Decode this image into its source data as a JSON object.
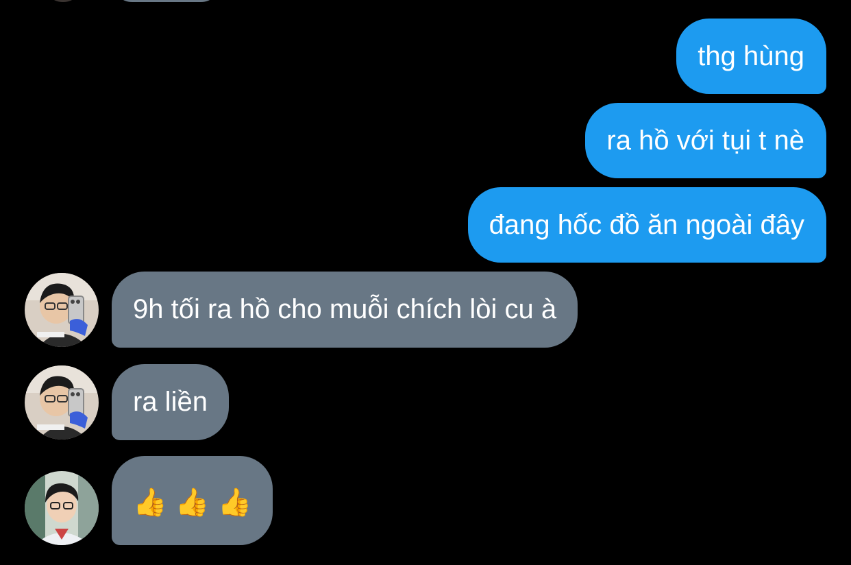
{
  "conversation": {
    "sent_messages": [
      {
        "text": "thg hùng"
      },
      {
        "text": "ra hồ với tụi t nè"
      },
      {
        "text": "đang hốc đồ ăn ngoài đây"
      }
    ],
    "received_messages": [
      {
        "text": "9h tối ra hồ cho muỗi chích lòi cu à"
      },
      {
        "text": "ra liền"
      },
      {
        "emojis": [
          "👍",
          "👍",
          "👍"
        ]
      }
    ]
  },
  "colors": {
    "background": "#000000",
    "sent_bubble": "#1d9bf0",
    "received_bubble": "#687785",
    "text": "#ffffff"
  },
  "icons": {
    "avatar_1": "user-avatar-photo",
    "avatar_2": "user-avatar-photo",
    "avatar_3": "user-avatar-photo"
  }
}
